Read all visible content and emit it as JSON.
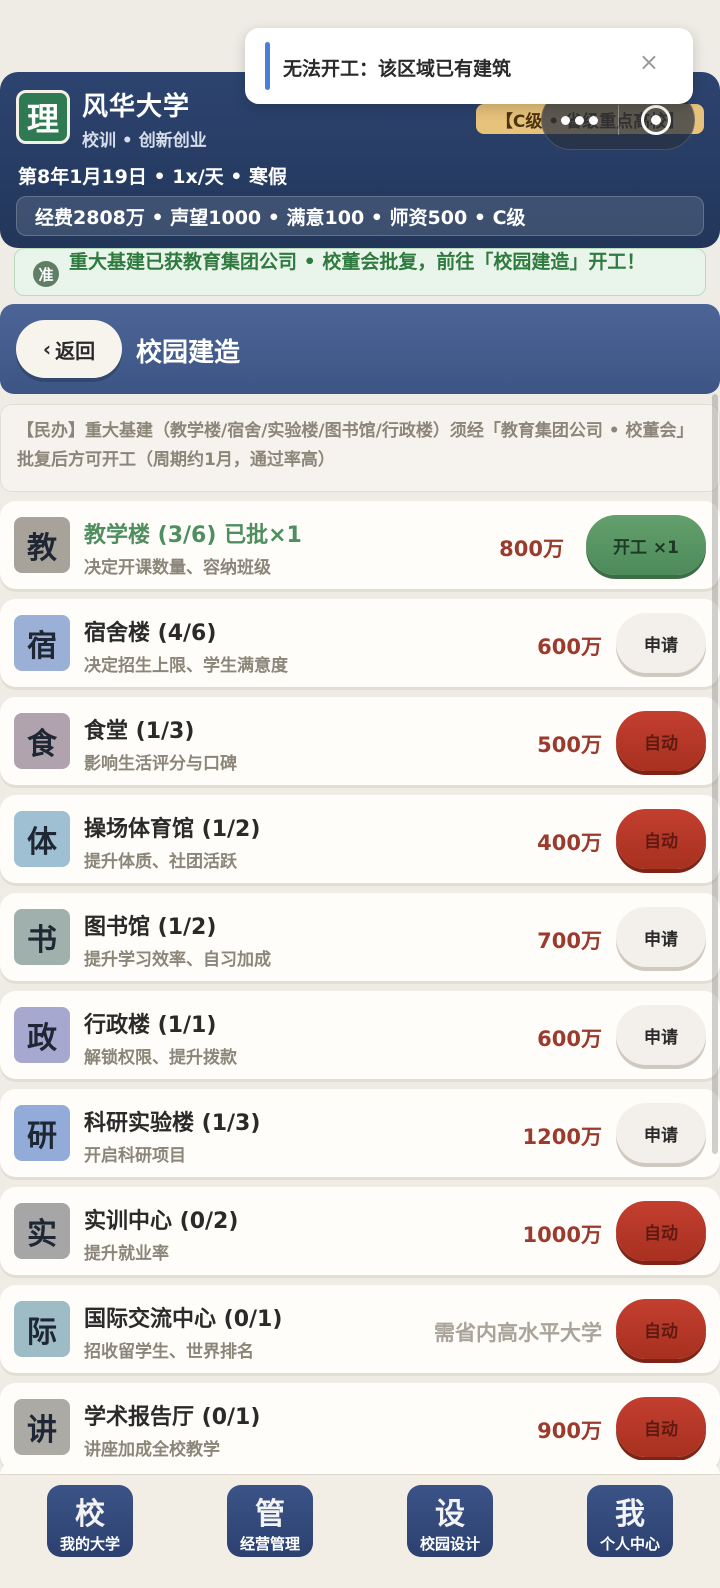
{
  "header": {
    "badge": "理",
    "school_name": "风华大学",
    "motto": "校训 • 创新创业",
    "rank_badge": "【C级 • 省级重点高校】",
    "date_line": "第8年1月19日 • 1x/天 • 寒假",
    "stats": "经费2808万 • 声望1000 • 满意100 • 师资500 • C级"
  },
  "toast": {
    "text": "无法开工：该区域已有建筑",
    "close": "×"
  },
  "notice": {
    "icon": "准",
    "text": "重大基建已获教育集团公司 • 校董会批复，前往「校园建造」开工！"
  },
  "page": {
    "back_arrow": "‹",
    "back_label": "返回",
    "title": "校园建造"
  },
  "intro": "【民办】重大基建（教学楼/宿舍/实验楼/图书馆/行政楼）须经「教育集团公司 • 校董会」批复后方可开工（周期约1月，通过率高）",
  "buildings": [
    {
      "icon": "教",
      "name": "教学楼 (3/6) 已批×1",
      "desc": "决定开课数量、容纳班级",
      "cost": "800万",
      "action": "开工 ×1",
      "icon_color": "#a8a39a"
    },
    {
      "icon": "宿",
      "name": "宿舍楼 (4/6)",
      "desc": "决定招生上限、学生满意度",
      "cost": "600万",
      "action": "申请",
      "icon_color": "#9bb0d6"
    },
    {
      "icon": "食",
      "name": "食堂 (1/3)",
      "desc": "影响生活评分与口碑",
      "cost": "500万",
      "action": "自动",
      "icon_color": "#b0a3ad"
    },
    {
      "icon": "体",
      "name": "操场体育馆 (1/2)",
      "desc": "提升体质、社团活跃",
      "cost": "400万",
      "action": "自动",
      "icon_color": "#9fbfd3"
    },
    {
      "icon": "书",
      "name": "图书馆 (1/2)",
      "desc": "提升学习效率、自习加成",
      "cost": "700万",
      "action": "申请",
      "icon_color": "#9fb0ad"
    },
    {
      "icon": "政",
      "name": "行政楼 (1/1)",
      "desc": "解锁权限、提升拨款",
      "cost": "600万",
      "action": "申请",
      "icon_color": "#a7a8cf"
    },
    {
      "icon": "研",
      "name": "科研实验楼 (1/3)",
      "desc": "开启科研项目",
      "cost": "1200万",
      "action": "申请",
      "icon_color": "#93abd8"
    },
    {
      "icon": "实",
      "name": "实训中心 (0/2)",
      "desc": "提升就业率",
      "cost": "1000万",
      "action": "自动",
      "icon_color": "#a6a6a6"
    },
    {
      "icon": "际",
      "name": "国际交流中心 (0/1)",
      "desc": "招收留学生、世界排名",
      "cost": "需省内高水平大学",
      "action": "自动",
      "icon_color": "#9ebcc6"
    },
    {
      "icon": "讲",
      "name": "学术报告厅 (0/1)",
      "desc": "讲座加成全校教学",
      "cost": "900万",
      "action": "自动",
      "icon_color": "#acaaa4"
    }
  ],
  "nav": [
    {
      "glyph": "校",
      "label": "我的大学"
    },
    {
      "glyph": "管",
      "label": "经营管理"
    },
    {
      "glyph": "设",
      "label": "校园设计"
    },
    {
      "glyph": "我",
      "label": "个人中心"
    }
  ]
}
